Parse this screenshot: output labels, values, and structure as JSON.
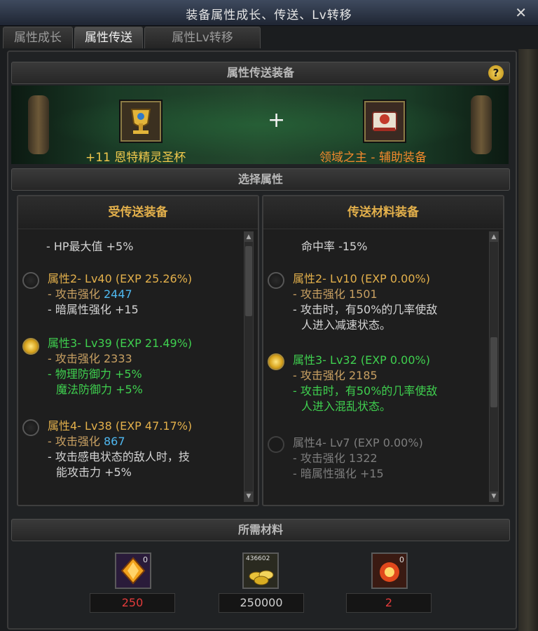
{
  "window": {
    "title": "装备属性成长、传送、Lv转移",
    "close_label": "✕"
  },
  "tabs": [
    {
      "label": "属性成长",
      "active": false
    },
    {
      "label": "属性传送",
      "active": true
    },
    {
      "label": "属性Lv转移",
      "active": false
    }
  ],
  "transfer_equipment": {
    "header": "属性传送装备",
    "help": "?",
    "plus": "+",
    "left_item": {
      "name": "+11 恩特精灵圣杯",
      "color": "#f2c94c"
    },
    "right_item": {
      "name": "领域之主 - 辅助装备",
      "color": "#f3892c"
    }
  },
  "select_attribute": {
    "header": "选择属性"
  },
  "receiver": {
    "header": "受传送装备",
    "top_line": "- HP最大值 +5%",
    "attrs": [
      {
        "title": "属性2- Lv40 (EXP 25.26%)",
        "selected": false,
        "l1_label": "- 攻击强化",
        "l1_value": "2447",
        "l2": "- 暗属性强化 +15"
      },
      {
        "title": "属性3- Lv39 (EXP 21.49%)",
        "selected": true,
        "l1_label": "- 攻击强化",
        "l1_value": "2333",
        "l2": "- 物理防御力 +5%",
        "l3": "魔法防御力 +5%"
      },
      {
        "title": "属性4- Lv38 (EXP 47.17%)",
        "selected": false,
        "l1_label": "- 攻击强化",
        "l1_value": "867",
        "l2": "- 攻击感电状态的敌人时，技",
        "l3": "能攻击力 +5%"
      }
    ]
  },
  "source": {
    "header": "传送材料装备",
    "top_line": "命中率 -15%",
    "attrs": [
      {
        "title": "属性2- Lv10 (EXP 0.00%)",
        "selected": false,
        "l1_label": "- 攻击强化",
        "l1_value": "1501",
        "l2": "- 攻击时，有50%的几率使敌",
        "l3": "人进入减速状态。"
      },
      {
        "title": "属性3- Lv32 (EXP 0.00%)",
        "selected": true,
        "l1_label": "- 攻击强化",
        "l1_value": "2185",
        "l2": "- 攻击时，有50%的几率使敌",
        "l3": "人进入混乱状态。"
      },
      {
        "title": "属性4- Lv7 (EXP 0.00%)",
        "selected": false,
        "disabled": true,
        "l1_label": "- 攻击强化",
        "l1_value": "1322",
        "l2": "- 暗属性强化 +15"
      }
    ]
  },
  "materials": {
    "header": "所需材料",
    "items": [
      {
        "icon": "orange-crystal-icon",
        "owned": "0",
        "required": "250",
        "required_color": "#e33b3b"
      },
      {
        "icon": "gold-coins-icon",
        "owned": "436602",
        "required": "250000",
        "required_color": "#cfcfcf"
      },
      {
        "icon": "fire-orb-icon",
        "owned": "0",
        "required": "2",
        "required_color": "#e33b3b"
      }
    ]
  }
}
